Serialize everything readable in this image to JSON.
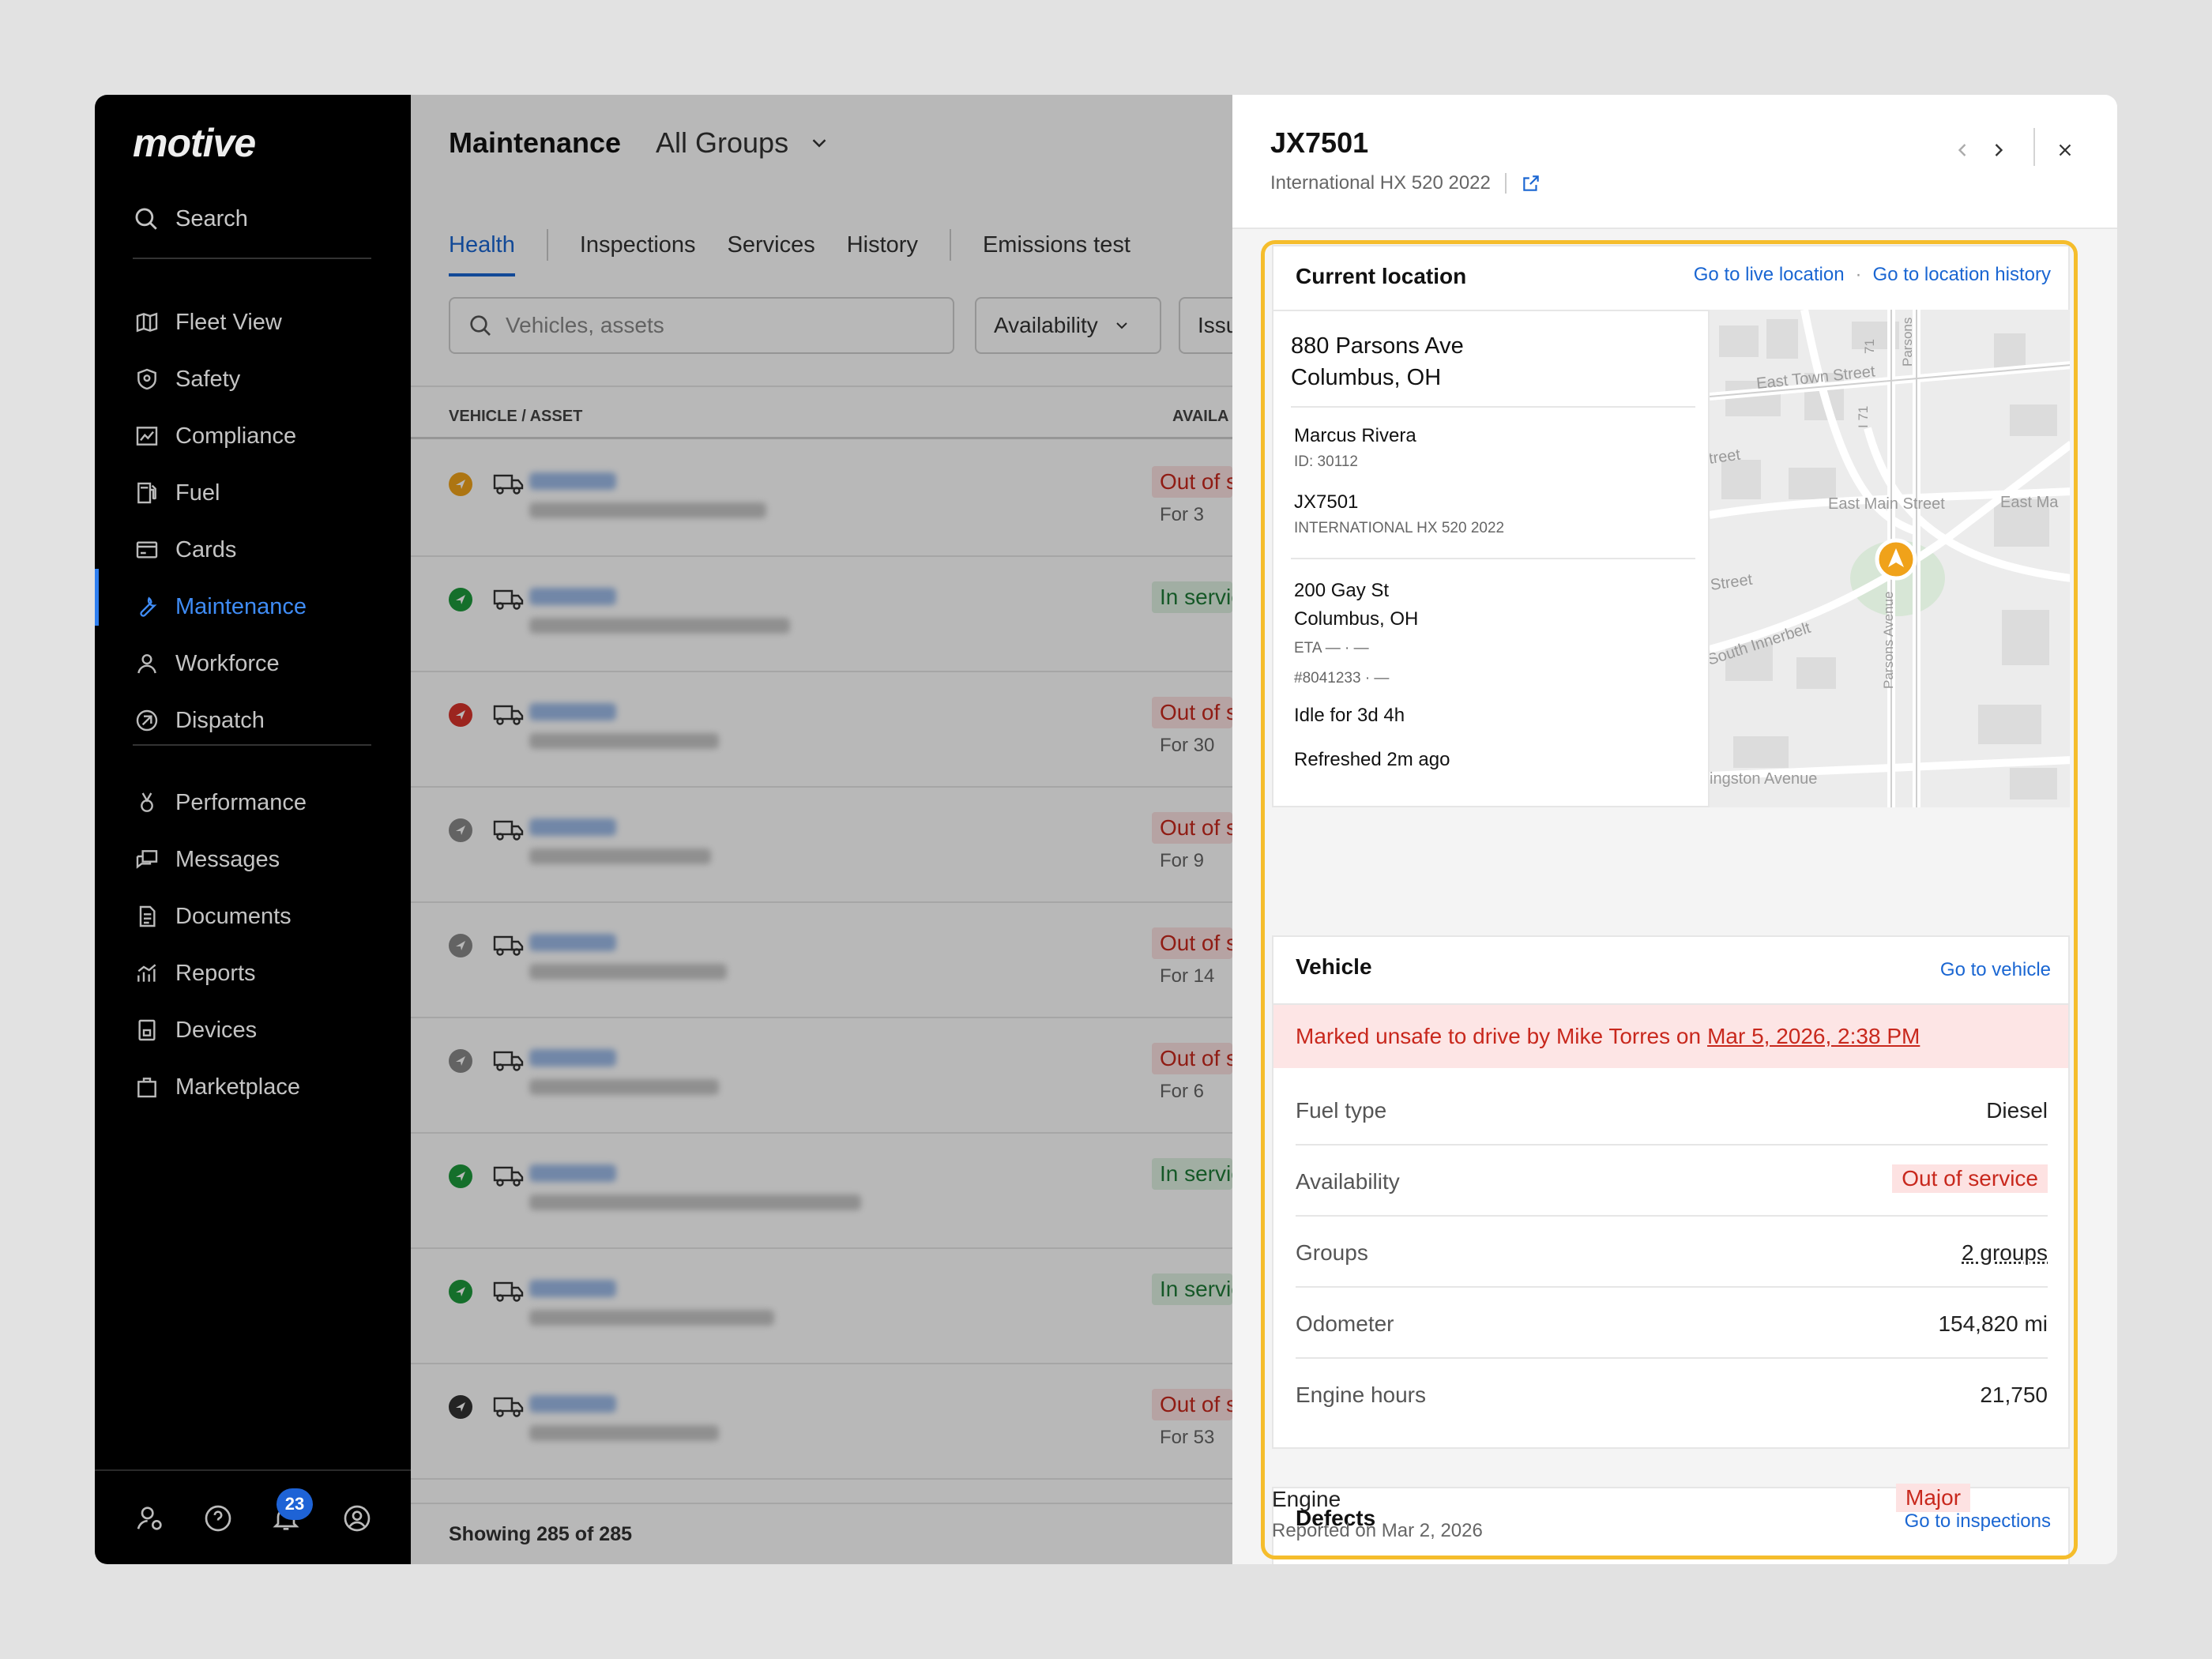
{
  "sidebar": {
    "logo": "motive",
    "search": "Search",
    "items": [
      {
        "label": "Fleet View",
        "icon": "map-icon"
      },
      {
        "label": "Safety",
        "icon": "shield-icon"
      },
      {
        "label": "Compliance",
        "icon": "chart-icon"
      },
      {
        "label": "Fuel",
        "icon": "fuel-pump-icon"
      },
      {
        "label": "Cards",
        "icon": "card-icon"
      },
      {
        "label": "Maintenance",
        "icon": "wrench-icon"
      },
      {
        "label": "Workforce",
        "icon": "person-icon"
      },
      {
        "label": "Dispatch",
        "icon": "dispatch-icon"
      },
      {
        "label": "Performance",
        "icon": "medal-icon"
      },
      {
        "label": "Messages",
        "icon": "messages-icon"
      },
      {
        "label": "Documents",
        "icon": "document-icon"
      },
      {
        "label": "Reports",
        "icon": "reports-icon"
      },
      {
        "label": "Devices",
        "icon": "device-icon"
      },
      {
        "label": "Marketplace",
        "icon": "bag-icon"
      }
    ],
    "notification_count": "23"
  },
  "main": {
    "title": "Maintenance",
    "group": "All Groups",
    "tabs": [
      "Health",
      "Inspections",
      "Services",
      "History",
      "Emissions test"
    ],
    "search_placeholder": "Vehicles, assets",
    "filter_availability": "Availability",
    "filter_issues": "Issu",
    "col_vehicle": "VEHICLE / ASSET",
    "col_avail": "AVAILA",
    "rows": [
      {
        "status": "Out of service",
        "for": "For 3",
        "color": "#f0a21a"
      },
      {
        "status": "In service",
        "for": "",
        "color": "#1e9a3c"
      },
      {
        "status": "Out of service",
        "for": "For 30",
        "color": "#d9342b"
      },
      {
        "status": "Out of service",
        "for": "For 9",
        "color": "#8a8a8a"
      },
      {
        "status": "Out of service",
        "for": "For 14",
        "color": "#8a8a8a"
      },
      {
        "status": "Out of service",
        "for": "For 6",
        "color": "#8a8a8a"
      },
      {
        "status": "In service",
        "for": "",
        "color": "#1e9a3c"
      },
      {
        "status": "In service",
        "for": "",
        "color": "#1e9a3c"
      },
      {
        "status": "Out of service",
        "for": "For 53",
        "color": "#333333"
      }
    ],
    "footer": "Showing 285 of 285"
  },
  "panel": {
    "title": "JX7501",
    "subtitle": "International HX 520 2022",
    "location": {
      "heading": "Current location",
      "link_live": "Go to live location",
      "dot": "·",
      "link_history": "Go to location history",
      "address1": "880 Parsons Ave",
      "address2": "Columbus, OH",
      "driver": "Marcus Rivera",
      "driver_id": "ID: 30112",
      "vehicle": "JX7501",
      "vehicle_model": "INTERNATIONAL HX 520 2022",
      "dest1": "200 Gay St",
      "dest2": "Columbus, OH",
      "eta": "ETA — · —",
      "order": "#8041233 · —",
      "idle": "Idle for 3d 4h",
      "refreshed": "Refreshed 2m ago",
      "map_labels": [
        "East Town Street",
        "East Main Street",
        "East Ma",
        "South Innerbelt",
        "Street",
        "treet",
        "ingston Avenue",
        "Parsons Avenue",
        "Parsons",
        "I 71",
        "71"
      ]
    },
    "vehicle": {
      "heading": "Vehicle",
      "link": "Go to vehicle",
      "unsafe_text": "Marked unsafe to drive by Mike Torres on",
      "unsafe_date": "Mar 5, 2026, 2:38 PM",
      "rows": [
        {
          "k": "Fuel type",
          "v": "Diesel"
        },
        {
          "k": "Availability",
          "v": "Out of service"
        },
        {
          "k": "Groups",
          "v": "2 groups"
        },
        {
          "k": "Odometer",
          "v": "154,820 mi"
        },
        {
          "k": "Engine hours",
          "v": "21,750"
        }
      ]
    },
    "defects": {
      "heading": "Defects",
      "link": "Go to inspections",
      "item": "Engine",
      "reported": "Reported on Mar 2, 2026",
      "severity": "Major"
    }
  },
  "colors": {
    "accent": "#1a66d2",
    "highlight": "#f5bd2c",
    "danger": "#c8281d"
  }
}
